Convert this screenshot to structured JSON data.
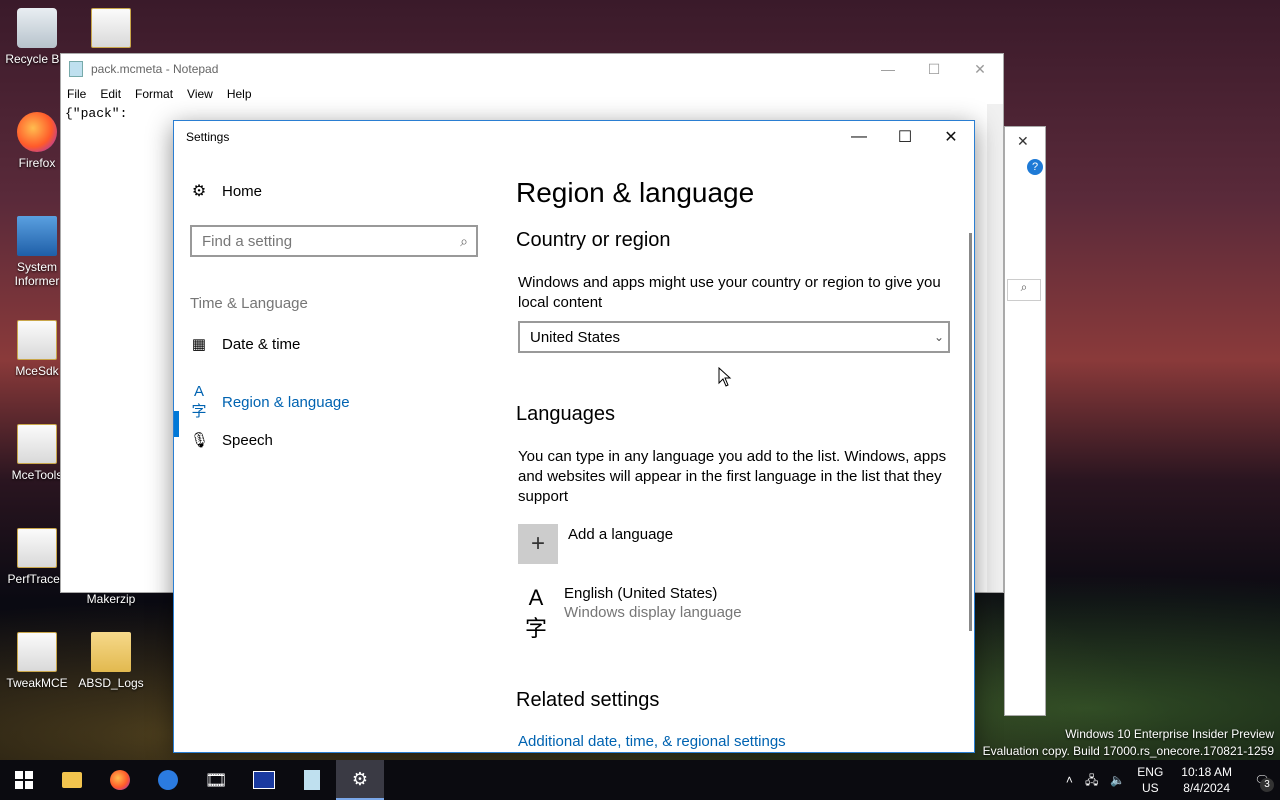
{
  "desktop": {
    "icons": [
      {
        "label": "Recycle Bin",
        "icon": "recycle-bin-icon"
      },
      {
        "label": "",
        "icon": "folder-doc-icon"
      },
      {
        "label": "Firefox",
        "icon": "firefox-icon"
      },
      {
        "label": "System Informer",
        "icon": "system-informer-icon"
      },
      {
        "label": "MceSdk",
        "icon": "folder-doc-icon"
      },
      {
        "label": "MceTools",
        "icon": "folder-doc-icon"
      },
      {
        "label": "PerfTracelr",
        "icon": "folder-doc-icon"
      },
      {
        "label": "Makerzip",
        "icon": "folder-icon"
      },
      {
        "label": "TweakMCE",
        "icon": "folder-doc-icon"
      },
      {
        "label": "ABSD_Logs",
        "icon": "folder-icon"
      }
    ],
    "watermark": {
      "line1": "Windows 10 Enterprise Insider Preview",
      "line2": "Evaluation copy. Build 17000.rs_onecore.170821-1259"
    }
  },
  "notepad": {
    "title": "pack.mcmeta - Notepad",
    "menu": [
      "File",
      "Edit",
      "Format",
      "View",
      "Help"
    ],
    "text": "{\"pack\":"
  },
  "settings": {
    "title": "Settings",
    "nav": {
      "home": "Home",
      "search_placeholder": "Find a setting",
      "group": "Time & Language",
      "items": [
        {
          "label": "Date & time",
          "icon": "calendar-clock-icon"
        },
        {
          "label": "Region & language",
          "icon": "language-icon"
        },
        {
          "label": "Speech",
          "icon": "microphone-icon"
        }
      ]
    },
    "page_title": "Region & language",
    "country": {
      "heading": "Country or region",
      "description": "Windows and apps might use your country or region to give you local content",
      "selected": "United States"
    },
    "languages": {
      "heading": "Languages",
      "description": "You can type in any language you add to the list. Windows, apps and websites will appear in the first language in the list that they support",
      "add_label": "Add a language",
      "installed": [
        {
          "name": "English (United States)",
          "sub": "Windows display language"
        }
      ]
    },
    "related": {
      "heading": "Related settings",
      "link": "Additional date, time, & regional settings"
    }
  },
  "taskbar": {
    "lang_top": "ENG",
    "lang_bottom": "US",
    "time": "10:18 AM",
    "date": "8/4/2024",
    "notification_count": "3"
  }
}
